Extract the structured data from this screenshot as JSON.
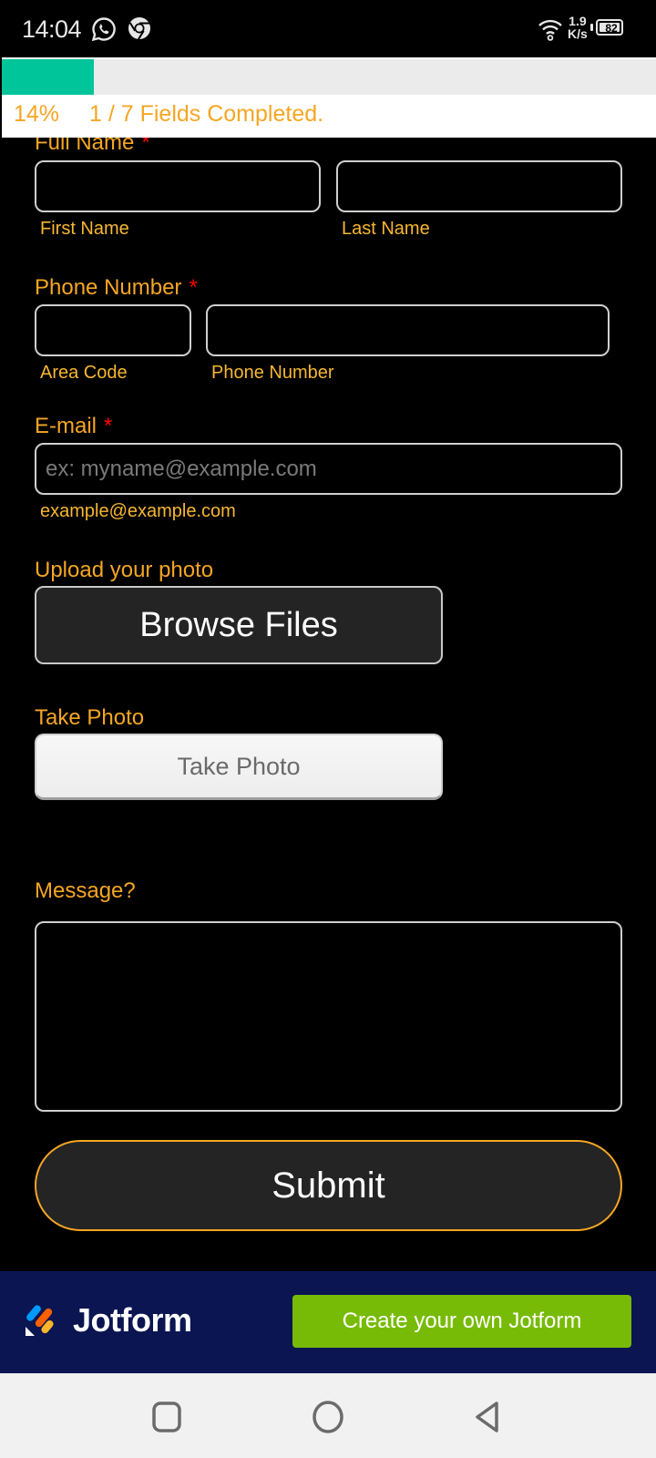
{
  "status_bar": {
    "time": "14:04",
    "notification_icons": [
      "whatsapp-icon",
      "chrome-icon"
    ],
    "net_speed_value": "1.9",
    "net_speed_unit": "K/s",
    "battery_level": "82"
  },
  "progress": {
    "percent_label": "14%",
    "fraction": 0.14,
    "fields_label": "1 / 7 Fields Completed.",
    "fill_color": "#00c49a"
  },
  "form": {
    "full_name": {
      "label": "Full Name",
      "required_mark": "*",
      "first_value": "",
      "last_value": "",
      "first_sublabel": "First Name",
      "last_sublabel": "Last Name"
    },
    "phone": {
      "label": "Phone Number",
      "required_mark": "*",
      "area_value": "",
      "number_value": "",
      "area_sublabel": "Area Code",
      "number_sublabel": "Phone Number"
    },
    "email": {
      "label": "E-mail",
      "required_mark": "*",
      "value": "",
      "placeholder": "ex: myname@example.com",
      "sublabel": "example@example.com"
    },
    "upload": {
      "label": "Upload your photo",
      "button_label": "Browse Files"
    },
    "take_photo": {
      "label": "Take Photo",
      "button_label": "Take Photo"
    },
    "message": {
      "label": "Message?",
      "value": ""
    },
    "submit_label": "Submit",
    "accent_color": "#f5a623"
  },
  "banner": {
    "brand_name": "Jotform",
    "cta_label": "Create your own Jotform",
    "background_color": "#0a1551",
    "cta_color": "#78bb07"
  },
  "navbar": {
    "buttons": [
      "recents-icon",
      "home-icon",
      "back-icon"
    ]
  }
}
